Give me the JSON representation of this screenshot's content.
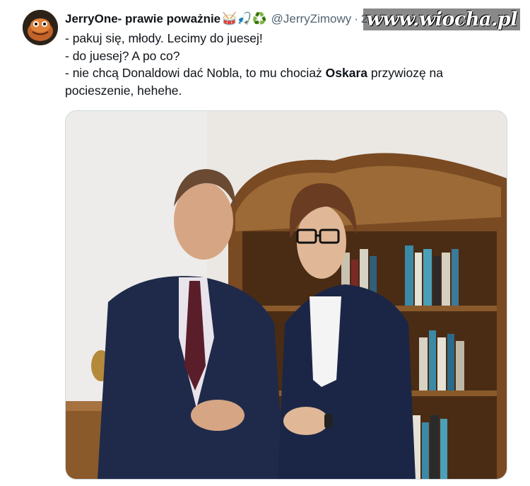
{
  "tweet": {
    "display_name": "JerryOne- prawie poważnie",
    "name_emojis": "🥁🎣♻️",
    "handle": "@JerryZimowy",
    "separator": "·",
    "time": "2",
    "lines": [
      "- pakuj się, młody. Lecimy do juesej!",
      "- do juesej? A po co?"
    ],
    "line3_before": "- nie chcą Donaldowi dać Nobla, to mu chociaż ",
    "line3_bold": "Oskara",
    "line3_after": " przywiozę na pocieszenie, hehehe."
  },
  "watermark": {
    "text": "www.wiocha.pl"
  },
  "media": {
    "alt": "photo",
    "colors": {
      "wall": "#e8e5e0",
      "wood": "#8a5a2b",
      "suit": "#1f2a4a",
      "tie": "#5a1e2a"
    }
  }
}
